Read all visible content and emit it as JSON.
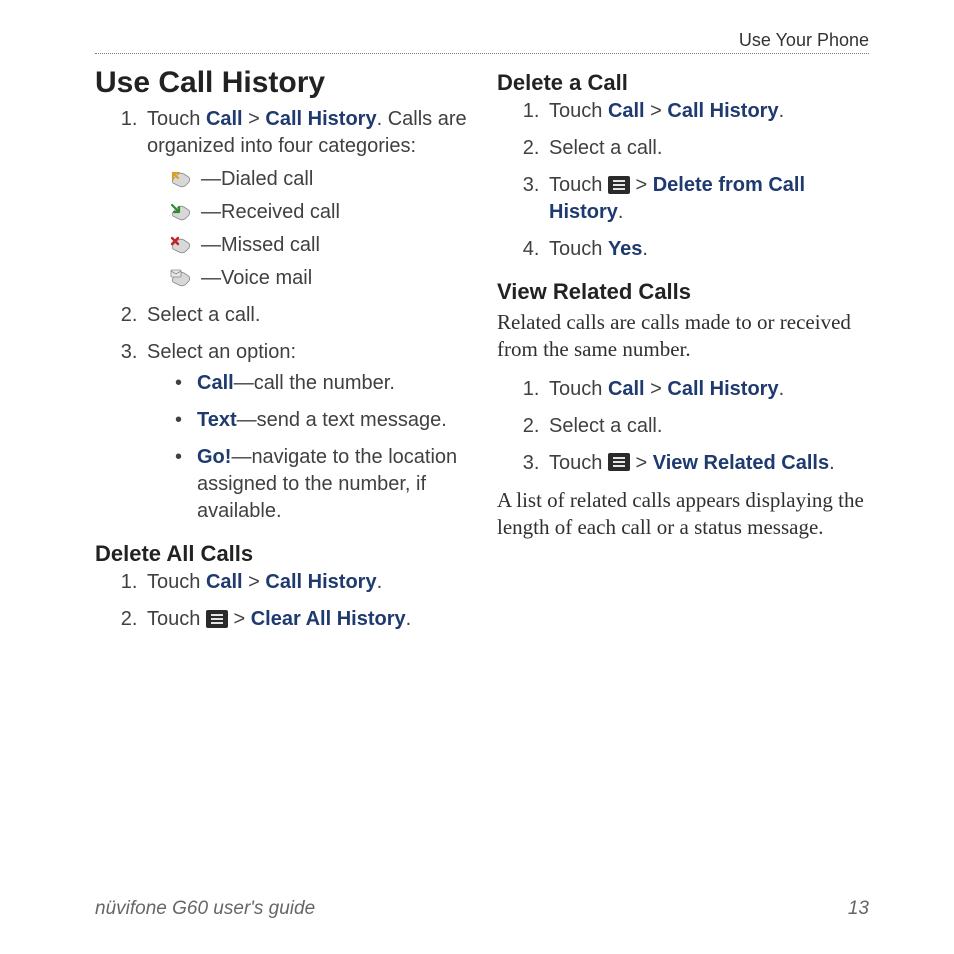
{
  "header": {
    "section": "Use Your Phone"
  },
  "left": {
    "h1": "Use Call History",
    "step1_pre": "Touch ",
    "step1_call": "Call",
    "step1_gt": " > ",
    "step1_hist": "Call History",
    "step1_post": ". Calls are organized into four categories:",
    "cat_dialed": "—Dialed call",
    "cat_received": "—Received call",
    "cat_missed": "—Missed call",
    "cat_voice": "—Voice mail",
    "step2": "Select a call.",
    "step3": "Select an option:",
    "opt_call_kw": "Call",
    "opt_call_desc": "—call the number.",
    "opt_text_kw": "Text",
    "opt_text_desc": "—send a text message.",
    "opt_go_kw": "Go!",
    "opt_go_desc": "—navigate to the location assigned to the number, if available.",
    "h2a": "Delete All Calls",
    "dac1_pre": "Touch ",
    "dac1_call": "Call",
    "dac1_gt": " > ",
    "dac1_hist": "Call History",
    "dac1_post": ".",
    "dac2_pre": "Touch ",
    "dac2_gt": " > ",
    "dac2_clear": "Clear All History",
    "dac2_post": "."
  },
  "right": {
    "h2a": "Delete a Call",
    "d1_pre": "Touch ",
    "d1_call": "Call",
    "d1_gt": " > ",
    "d1_hist": "Call History",
    "d1_post": ".",
    "d2": "Select a call.",
    "d3_pre": "Touch ",
    "d3_gt": " > ",
    "d3_del": "Delete from Call History",
    "d3_post": ".",
    "d4_pre": "Touch ",
    "d4_yes": "Yes",
    "d4_post": ".",
    "h2b": "View Related Calls",
    "intro": "Related calls are calls made to or received from the same number.",
    "v1_pre": "Touch ",
    "v1_call": "Call",
    "v1_gt": " > ",
    "v1_hist": "Call History",
    "v1_post": ".",
    "v2": "Select a call.",
    "v3_pre": "Touch ",
    "v3_gt": " > ",
    "v3_view": "View Related Calls",
    "v3_post": ".",
    "outro": "A list of related calls appears displaying the length of each call or a status message."
  },
  "footer": {
    "title": "nüvifone G60 user's guide",
    "page": "13"
  }
}
